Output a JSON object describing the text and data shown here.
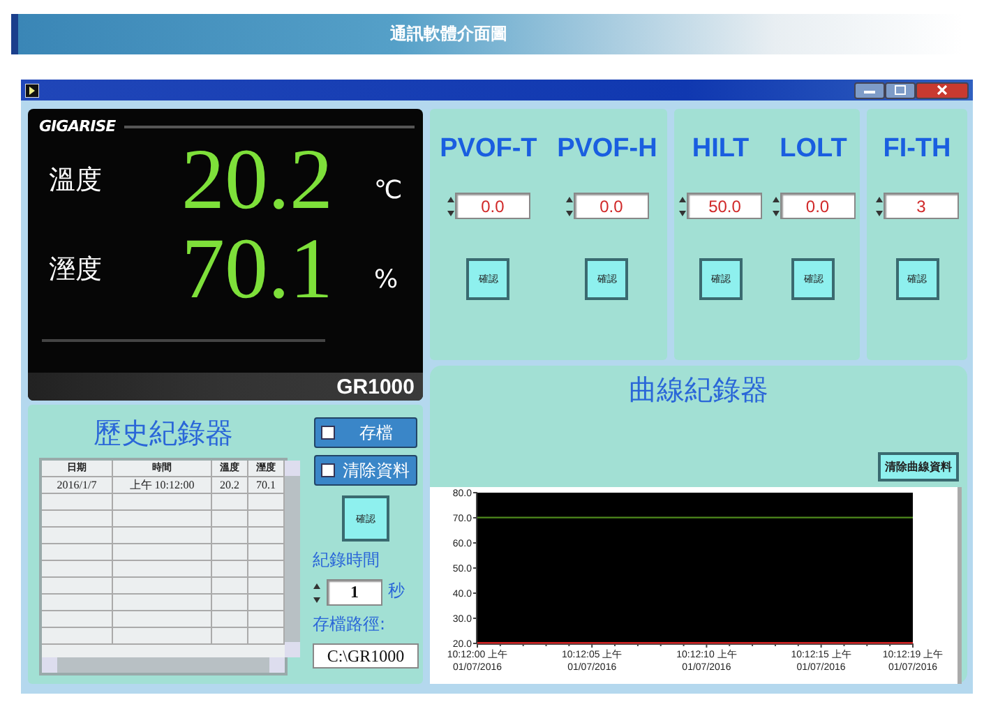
{
  "banner": {
    "title": "通訊軟體介面圖"
  },
  "display": {
    "logo": "GIGARISE",
    "readings": [
      {
        "label": "溫度",
        "value": "20.2",
        "unit": "℃"
      },
      {
        "label": "溼度",
        "value": "70.1",
        "unit": "%"
      }
    ],
    "model": "GR1000"
  },
  "settings": {
    "groups": [
      {
        "params": [
          {
            "name": "PVOF-T",
            "value": "0.0",
            "button": "確認"
          },
          {
            "name": "PVOF-H",
            "value": "0.0",
            "button": "確認"
          }
        ]
      },
      {
        "params": [
          {
            "name": "HILT",
            "value": "50.0",
            "button": "確認"
          },
          {
            "name": "LOLT",
            "value": "0.0",
            "button": "確認"
          }
        ]
      },
      {
        "params": [
          {
            "name": "FI-TH",
            "value": "3",
            "button": "確認"
          }
        ]
      }
    ]
  },
  "history": {
    "title": "歷史紀錄器",
    "columns": [
      "日期",
      "時間",
      "溫度",
      "溼度"
    ],
    "rows": [
      [
        "2016/1/7",
        "上午 10:12:00",
        "20.2",
        "70.1"
      ]
    ],
    "toggles": [
      {
        "label": "存檔",
        "checked": false
      },
      {
        "label": "清除資料",
        "checked": false
      }
    ],
    "confirm": "確認",
    "interval_label": "紀錄時間",
    "interval": "1",
    "interval_unit": "秒",
    "path_label": "存檔路徑:",
    "path": "C:\\GR1000"
  },
  "chart_panel": {
    "title": "曲線紀錄器",
    "clear_button": "清除曲線資料",
    "chart_data": {
      "type": "line",
      "categories": [
        "10:12:00 上午\n01/07/2016",
        null,
        null,
        null,
        null,
        "10:12:05 上午\n01/07/2016",
        null,
        null,
        null,
        null,
        "10:12:10 上午\n01/07/2016",
        null,
        null,
        null,
        null,
        "10:12:15 上午\n01/07/2016",
        null,
        null,
        null,
        "10:12:19 上午\n01/07/2016"
      ],
      "series": [
        {
          "color": "#4e8a1c",
          "values": [
            70.1,
            70.1,
            70.1,
            70.1,
            70.1,
            70.1,
            70.1,
            70.1,
            70.1,
            70.1,
            70.1,
            70.1,
            70.1,
            70.1,
            70.1,
            70.1,
            70.1,
            70.1,
            70.1,
            70.1
          ]
        },
        {
          "color": "#d02020",
          "values": [
            20.2,
            20.2,
            20.2,
            20.2,
            20.2,
            20.2,
            20.2,
            20.2,
            20.2,
            20.2,
            20.2,
            20.2,
            20.2,
            20.2,
            20.2,
            20.2,
            20.2,
            20.2,
            20.2,
            20.2
          ]
        }
      ],
      "ylim": [
        20,
        80
      ],
      "yticks": [
        {
          "value": 20,
          "label": "20.0"
        },
        {
          "value": 30,
          "label": "30.0"
        },
        {
          "value": 40,
          "label": "40.0"
        },
        {
          "value": 50,
          "label": "50.0"
        },
        {
          "value": 60,
          "label": "60.0"
        },
        {
          "value": 70,
          "label": "70.0"
        },
        {
          "value": 80,
          "label": "80.0"
        }
      ]
    }
  }
}
